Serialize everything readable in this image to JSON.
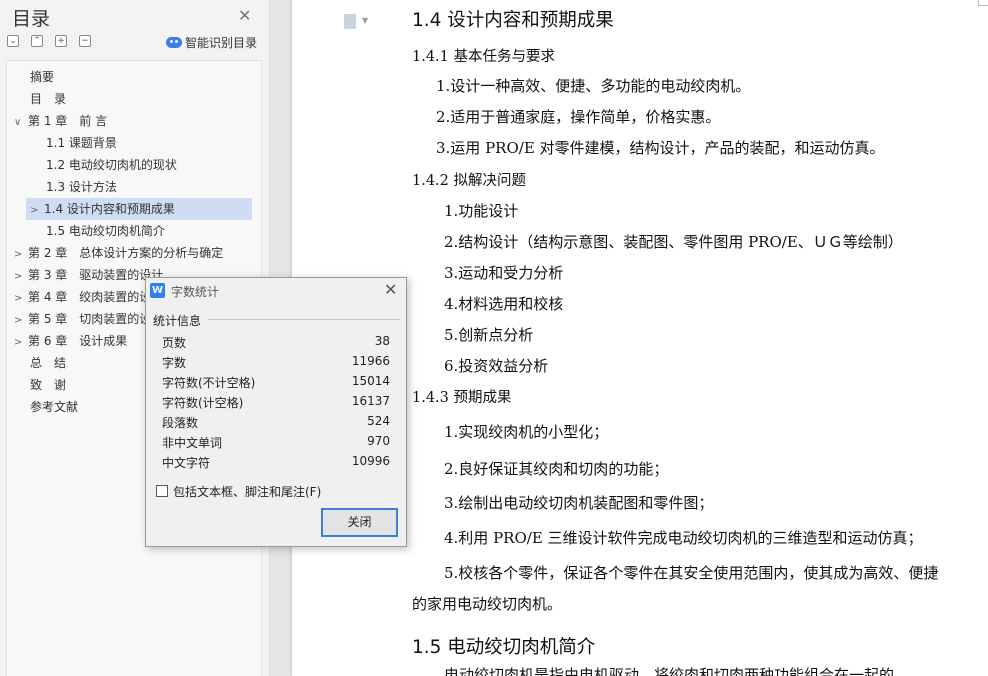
{
  "nav": {
    "title": "目录",
    "smart_toc": "智能识别目录",
    "tools": [
      "⌄",
      "⌃",
      "+",
      "−"
    ],
    "items": [
      {
        "label": "摘要",
        "arrow": ""
      },
      {
        "label": "目　录",
        "arrow": ""
      },
      {
        "label": "第 1 章　前 言",
        "arrow": "∨"
      },
      {
        "label": "1.1 课题背景",
        "arrow": ""
      },
      {
        "label": "1.2 电动绞切肉机的现状",
        "arrow": ""
      },
      {
        "label": "1.3 设计方法",
        "arrow": ""
      },
      {
        "label": "1.4 设计内容和预期成果",
        "arrow": ">"
      },
      {
        "label": "1.5 电动绞切肉机简介",
        "arrow": ""
      },
      {
        "label": "第 2 章　总体设计方案的分析与确定",
        "arrow": ">"
      },
      {
        "label": "第 3 章　驱动装置的设计",
        "arrow": ">"
      },
      {
        "label": "第 4 章　绞肉装置的设",
        "arrow": ">"
      },
      {
        "label": "第 5 章　切肉装置的设",
        "arrow": ">"
      },
      {
        "label": "第 6 章　设计成果",
        "arrow": ">"
      },
      {
        "label": "总　结",
        "arrow": ""
      },
      {
        "label": "致　谢",
        "arrow": ""
      },
      {
        "label": "参考文献",
        "arrow": ""
      }
    ]
  },
  "doc": {
    "lines": [
      "1.4 设计内容和预期成果",
      "1.4.1  基本任务与要求",
      "1.设计一种高效、便捷、多功能的电动绞肉机。",
      "2.适用于普通家庭，操作简单，价格实惠。",
      "3.运用 PRO/E 对零件建模，结构设计，产品的装配，和运动仿真。",
      "1.4.2  拟解决问题",
      "1.功能设计",
      "2.结构设计（结构示意图、装配图、零件图用 PRO/E、ＵＧ等绘制）",
      "3.运动和受力分析",
      "4.材料选用和校核",
      "5.创新点分析",
      "6.投资效益分析",
      "1.4.3 预期成果",
      "1.实现绞肉机的小型化；",
      "2.良好保证其绞肉和切肉的功能；",
      "3.绘制出电动绞切肉机装配图和零件图；",
      "4.利用 PRO/E 三维设计软件完成电动绞切肉机的三维造型和运动仿真；",
      "5.校核各个零件，保证各个零件在其安全使用范围内，使其成为高效、便捷",
      "的家用电动绞切肉机。",
      "1.5 电动绞切肉机简介",
      "电动绞切肉机是指由电机驱动，将绞肉和切肉两种功能组合在一起的"
    ]
  },
  "dialog": {
    "title": "字数统计",
    "group": "统计信息",
    "rows": [
      {
        "label": "页数",
        "value": "38"
      },
      {
        "label": "字数",
        "value": "11966"
      },
      {
        "label": "字符数(不计空格)",
        "value": "15014"
      },
      {
        "label": "字符数(计空格)",
        "value": "16137"
      },
      {
        "label": "段落数",
        "value": "524"
      },
      {
        "label": "非中文单词",
        "value": "970"
      },
      {
        "label": "中文字符",
        "value": "10996"
      }
    ],
    "checkbox_label": "包括文本框、脚注和尾注(F)",
    "close_label": "关闭",
    "logo": "W"
  }
}
